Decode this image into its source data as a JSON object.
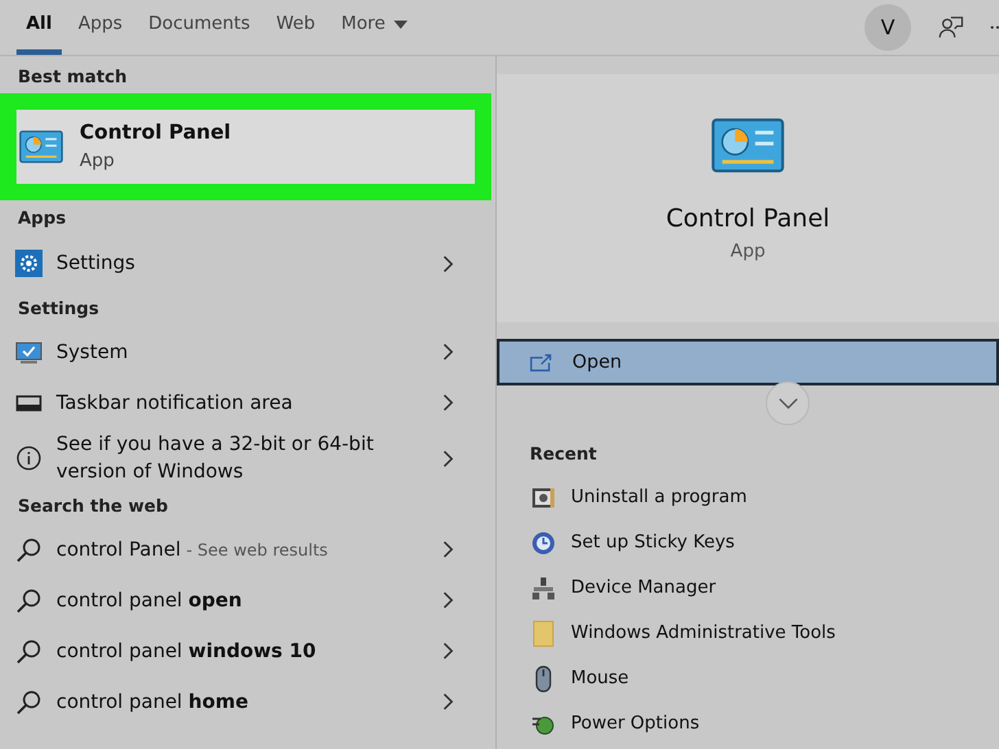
{
  "tabs": [
    {
      "label": "All",
      "selected": true
    },
    {
      "label": "Apps",
      "selected": false
    },
    {
      "label": "Documents",
      "selected": false
    },
    {
      "label": "Web",
      "selected": false
    },
    {
      "label": "More",
      "selected": false,
      "kind": "dropdown"
    }
  ],
  "account": {
    "initial": "V"
  },
  "best_match": {
    "heading": "Best match",
    "title": "Control Panel",
    "subtitle": "App",
    "highlighted": true
  },
  "sections": [
    {
      "heading": "Apps",
      "items": [
        {
          "kind": "gear",
          "label": "Settings"
        }
      ]
    },
    {
      "heading": "Settings",
      "items": [
        {
          "kind": "monitor",
          "label": "System"
        },
        {
          "kind": "taskbar",
          "label": "Taskbar notification area"
        },
        {
          "kind": "info",
          "label": "See if you have a 32-bit or 64-bit version of Windows"
        }
      ]
    },
    {
      "heading": "Search the web",
      "items": [
        {
          "kind": "search",
          "label": "control Panel",
          "suffix": "- See web results"
        },
        {
          "kind": "search",
          "label": "control panel **open**"
        },
        {
          "kind": "search",
          "label": "control panel **windows 10**"
        },
        {
          "kind": "search",
          "label": "control panel **home**"
        }
      ]
    }
  ],
  "preview": {
    "title": "Control Panel",
    "subtitle": "App"
  },
  "actions": [
    {
      "label": "Open",
      "selected": true
    }
  ],
  "recent": {
    "heading": "Recent",
    "items": [
      {
        "kind": "uninstall",
        "label": "Uninstall a program"
      },
      {
        "kind": "sticky",
        "label": "Set up Sticky Keys"
      },
      {
        "kind": "device",
        "label": "Device Manager"
      },
      {
        "kind": "folder",
        "label": "Windows Administrative Tools"
      },
      {
        "kind": "mouse",
        "label": "Mouse"
      },
      {
        "kind": "power",
        "label": "Power Options"
      }
    ]
  }
}
